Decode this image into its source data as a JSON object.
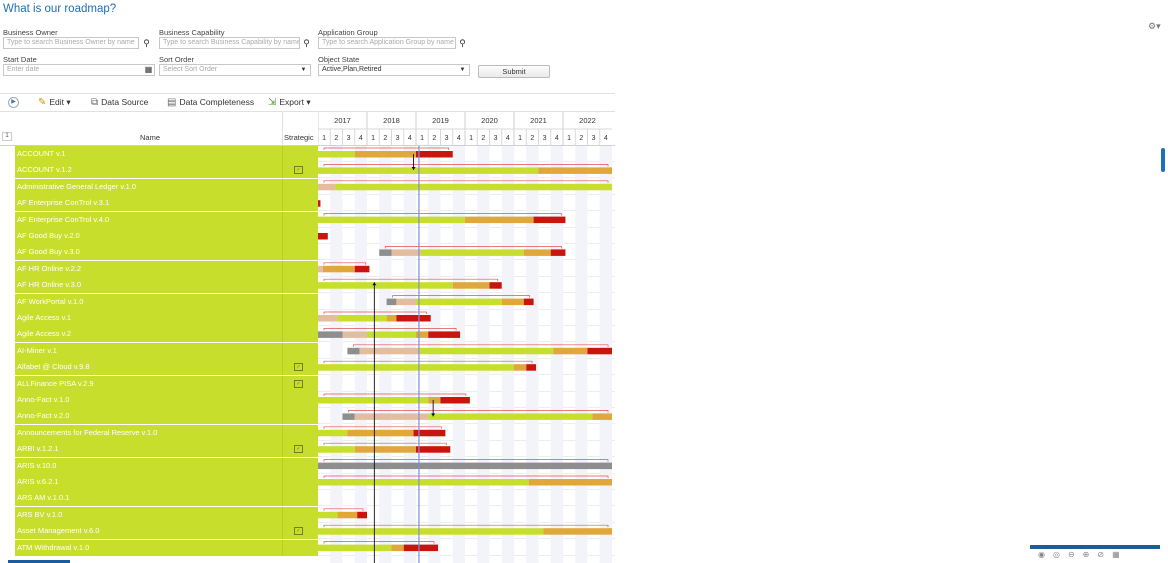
{
  "page": {
    "title": "What is our roadmap?"
  },
  "filters": {
    "business_owner": {
      "label": "Business Owner",
      "placeholder": "Type to search Business Owner by name"
    },
    "business_capability": {
      "label": "Business Capability",
      "placeholder": "Type to search Business Capability by name"
    },
    "application_group": {
      "label": "Application Group",
      "placeholder": "Type to search Application Group by name"
    },
    "start_date": {
      "label": "Start Date",
      "placeholder": "Enter date"
    },
    "sort_order": {
      "label": "Sort Order",
      "placeholder": "Select Sort Order"
    },
    "object_state": {
      "label": "Object State",
      "value": "Active,Plan,Retired"
    },
    "submit_label": "Submit"
  },
  "toolbar": {
    "edit": "Edit",
    "data_source": "Data Source",
    "data_completeness": "Data Completeness",
    "export": "Export"
  },
  "grid": {
    "row_number_header": "1",
    "name_header": "Name",
    "strategic_header": "Strategic",
    "years": [
      "2017",
      "2018",
      "2019",
      "2020",
      "2021",
      "2022"
    ],
    "quarters": [
      "1",
      "2",
      "3",
      "4"
    ],
    "today_position": 2019.06
  },
  "colors": {
    "row_green": "#c7de2c",
    "active": "#c7de2c",
    "plan": "#e0a73a",
    "retired": "#c8150e",
    "draft_grey": "#8e8e8e",
    "beige": "#e4bca0",
    "today_line": "#7d8fdc",
    "dependency": "#e05050",
    "title_blue": "#1f6fb2"
  },
  "rows": [
    {
      "name": "ACCOUNT v.1",
      "strategic": false,
      "bars": [
        [
          2017,
          2017.75,
          "active"
        ],
        [
          2017.75,
          2019.0,
          "plan"
        ],
        [
          2019.0,
          2019.75,
          "retired"
        ]
      ]
    },
    {
      "name": "ACCOUNT v.1.2",
      "strategic": true,
      "bars": [
        [
          2017,
          2021.5,
          "active"
        ],
        [
          2021.5,
          2023,
          "plan"
        ]
      ]
    },
    {
      "name": "Administrative General Ledger v.1.0",
      "strategic": false,
      "bars": [
        [
          2017,
          2017.35,
          "beige"
        ],
        [
          2017.35,
          2023,
          "active"
        ]
      ]
    },
    {
      "name": "AF Enterprise ConTrol v.3.1",
      "strategic": false,
      "bars": [
        [
          2017,
          2017.05,
          "retired"
        ]
      ]
    },
    {
      "name": "AF Enterprise ConTrol v.4.0",
      "strategic": false,
      "bars": [
        [
          2017,
          2020.0,
          "active"
        ],
        [
          2020.0,
          2021.4,
          "plan"
        ],
        [
          2021.4,
          2022.05,
          "retired"
        ]
      ]
    },
    {
      "name": "AF Good Buy v.2.0",
      "strategic": false,
      "bars": [
        [
          2017,
          2017.2,
          "retired"
        ]
      ]
    },
    {
      "name": "AF Good Buy v.3.0",
      "strategic": false,
      "bars": [
        [
          2018.25,
          2018.5,
          "draft_grey"
        ],
        [
          2018.5,
          2019.1,
          "beige"
        ],
        [
          2019.1,
          2021.2,
          "active"
        ],
        [
          2021.2,
          2021.75,
          "plan"
        ],
        [
          2021.75,
          2022.05,
          "retired"
        ]
      ]
    },
    {
      "name": "AF HR Online v.2.2",
      "strategic": false,
      "bars": [
        [
          2017,
          2017.1,
          "beige"
        ],
        [
          2017.1,
          2017.75,
          "plan"
        ],
        [
          2017.75,
          2018.05,
          "retired"
        ]
      ]
    },
    {
      "name": "AF HR Online v.3.0",
      "strategic": false,
      "bars": [
        [
          2017,
          2019.75,
          "active"
        ],
        [
          2019.75,
          2020.5,
          "plan"
        ],
        [
          2020.5,
          2020.75,
          "retired"
        ]
      ]
    },
    {
      "name": "AF WorkPortal v.1.0",
      "strategic": false,
      "bars": [
        [
          2018.4,
          2018.6,
          "draft_grey"
        ],
        [
          2018.6,
          2019.0,
          "beige"
        ],
        [
          2019.0,
          2020.75,
          "active"
        ],
        [
          2020.75,
          2021.2,
          "plan"
        ],
        [
          2021.2,
          2021.4,
          "retired"
        ]
      ]
    },
    {
      "name": "Agile Access v.1",
      "strategic": false,
      "bars": [
        [
          2017,
          2017.4,
          "beige"
        ],
        [
          2017.4,
          2018.4,
          "active"
        ],
        [
          2018.4,
          2018.6,
          "plan"
        ],
        [
          2018.6,
          2019.3,
          "retired"
        ]
      ]
    },
    {
      "name": "Agile Access v.2",
      "strategic": false,
      "bars": [
        [
          2017,
          2017.5,
          "draft_grey"
        ],
        [
          2017.5,
          2018.0,
          "beige"
        ],
        [
          2018.0,
          2019.0,
          "active"
        ],
        [
          2019.0,
          2019.25,
          "plan"
        ],
        [
          2019.25,
          2019.9,
          "retired"
        ]
      ]
    },
    {
      "name": "AI-Miner v.1",
      "strategic": false,
      "bars": [
        [
          2017.6,
          2017.85,
          "draft_grey"
        ],
        [
          2017.85,
          2019.05,
          "beige"
        ],
        [
          2019.05,
          2021.8,
          "active"
        ],
        [
          2021.8,
          2022.5,
          "plan"
        ],
        [
          2022.5,
          2023,
          "retired"
        ]
      ]
    },
    {
      "name": "Alfabet @ Cloud v.9.8",
      "strategic": true,
      "bars": [
        [
          2017,
          2021.0,
          "active"
        ],
        [
          2021.0,
          2021.25,
          "plan"
        ],
        [
          2021.25,
          2021.45,
          "retired"
        ]
      ]
    },
    {
      "name": "ALLFinance PISA v.2.9",
      "strategic": true,
      "bars": []
    },
    {
      "name": "Anno-Fact v.1.0",
      "strategic": false,
      "bars": [
        [
          2017,
          2019.25,
          "active"
        ],
        [
          2019.25,
          2019.5,
          "plan"
        ],
        [
          2019.5,
          2020.1,
          "retired"
        ]
      ]
    },
    {
      "name": "Anno-Fact v.2.0",
      "strategic": false,
      "bars": [
        [
          2017.5,
          2017.75,
          "draft_grey"
        ],
        [
          2017.75,
          2019.25,
          "beige"
        ],
        [
          2019.25,
          2022.6,
          "active"
        ],
        [
          2022.6,
          2023,
          "plan"
        ]
      ]
    },
    {
      "name": "Announcements for Federal Reserve v.1.0",
      "strategic": false,
      "bars": [
        [
          2017,
          2017.6,
          "active"
        ],
        [
          2017.6,
          2018.95,
          "plan"
        ],
        [
          2018.95,
          2019.6,
          "retired"
        ]
      ]
    },
    {
      "name": "ARBI v.1.2.1",
      "strategic": true,
      "bars": [
        [
          2017,
          2017.75,
          "active"
        ],
        [
          2017.75,
          2019.0,
          "plan"
        ],
        [
          2019.0,
          2019.7,
          "retired"
        ]
      ]
    },
    {
      "name": "ARIS v.10.0",
      "strategic": false,
      "bars": [
        [
          2017,
          2023,
          "draft_grey"
        ]
      ]
    },
    {
      "name": "ARIS v.6.2.1",
      "strategic": false,
      "bars": [
        [
          2017,
          2021.3,
          "active"
        ],
        [
          2021.3,
          2023,
          "plan"
        ]
      ]
    },
    {
      "name": "ARS AM v.1.0.1",
      "strategic": false,
      "bars": []
    },
    {
      "name": "ARS BV v.1.0",
      "strategic": false,
      "bars": [
        [
          2017,
          2017.4,
          "active"
        ],
        [
          2017.4,
          2017.8,
          "plan"
        ],
        [
          2017.8,
          2018.0,
          "retired"
        ]
      ]
    },
    {
      "name": "Asset Management v.6.0",
      "strategic": true,
      "bars": [
        [
          2017,
          2021.6,
          "active"
        ],
        [
          2021.6,
          2023,
          "plan"
        ]
      ]
    },
    {
      "name": "ATM Withdrawal v.1.0",
      "strategic": false,
      "bars": [
        [
          2017,
          2018.5,
          "active"
        ],
        [
          2018.5,
          2018.75,
          "plan"
        ],
        [
          2018.75,
          2019.45,
          "retired"
        ]
      ]
    }
  ]
}
